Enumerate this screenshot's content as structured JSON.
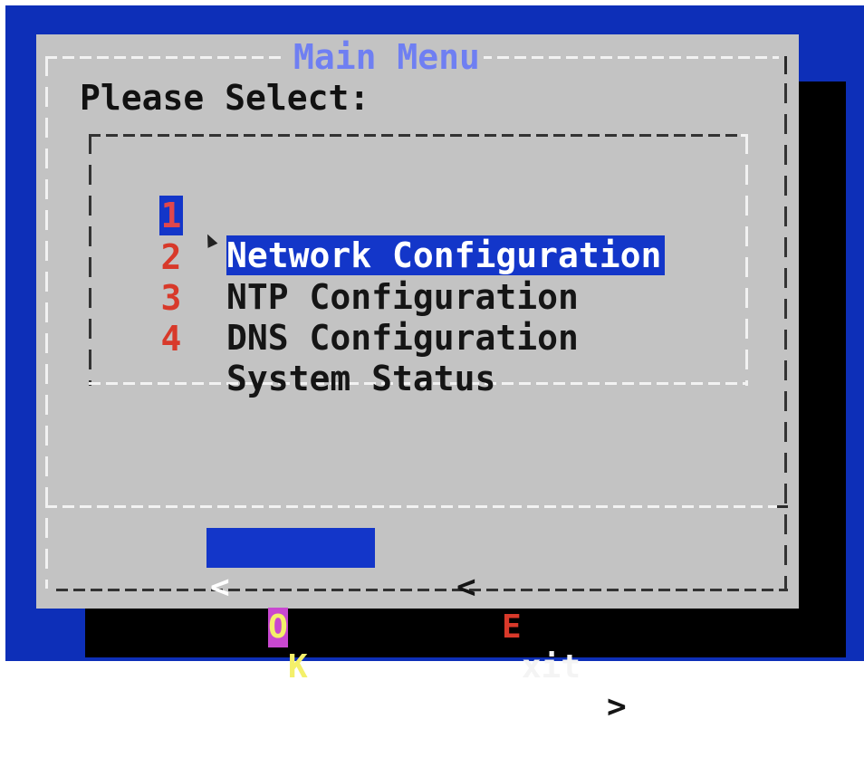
{
  "dialog": {
    "title": "Main Menu",
    "prompt": "Please Select:"
  },
  "menu": {
    "items": [
      {
        "tag": "1",
        "label": "Network Configuration",
        "selected": true
      },
      {
        "tag": "2",
        "label": "NTP Configuration",
        "selected": false
      },
      {
        "tag": "3",
        "label": "DNS Configuration",
        "selected": false
      },
      {
        "tag": "4",
        "label": "System Status",
        "selected": false
      }
    ]
  },
  "buttons": {
    "ok": {
      "left": "<",
      "hotkey": "O",
      "rest": "K",
      "right": ">"
    },
    "exit": {
      "left": "<",
      "hotkey": "E",
      "rest": "xit",
      "right": ">"
    }
  },
  "colors": {
    "screen_background": "#0d2fb8",
    "dialog_background": "#c3c3c3",
    "title": "#6f7ff2",
    "selection": "#1336c9",
    "menu_tag": "#d8392a",
    "ok_hotkey_bg": "#c948d0",
    "ok_text": "#f4f06a"
  }
}
